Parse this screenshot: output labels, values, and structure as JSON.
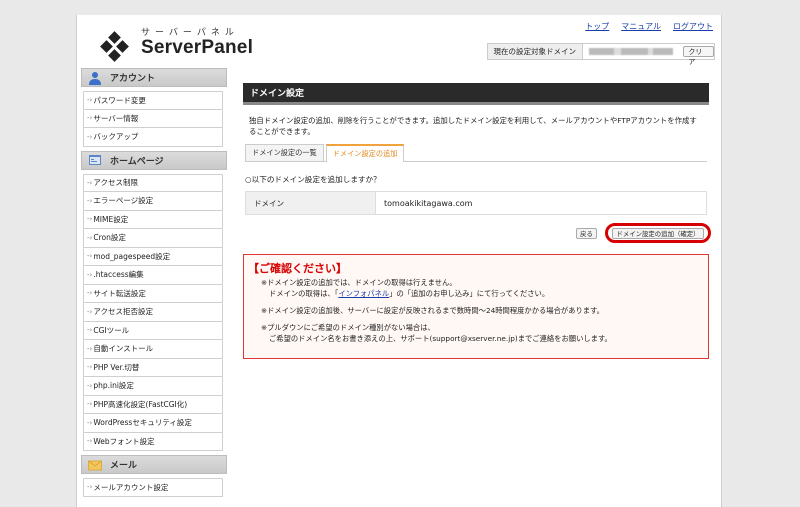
{
  "header": {
    "logo_kana": "サーバーパネル",
    "logo_word": "ServerPanel",
    "links": [
      "トップ",
      "マニュアル",
      "ログアウト"
    ],
    "target_label": "現在の設定対象ドメイン",
    "clear_label": "クリア"
  },
  "sidebar": {
    "sections": [
      {
        "title": "アカウント",
        "icon": "user-icon",
        "items": [
          "パスワード変更",
          "サーバー情報",
          "バックアップ"
        ]
      },
      {
        "title": "ホームページ",
        "icon": "homepage-icon",
        "items": [
          "アクセス制限",
          "エラーページ設定",
          "MIME設定",
          "Cron設定",
          "mod_pagespeed設定",
          ".htaccess編集",
          "サイト転送設定",
          "アクセス拒否設定",
          "CGIツール",
          "自動インストール",
          "PHP Ver.切替",
          "php.ini設定",
          "PHP高速化設定(FastCGI化)",
          "WordPressセキュリティ設定",
          "Webフォント設定"
        ]
      },
      {
        "title": "メール",
        "icon": "mail-icon",
        "items": [
          "メールアカウント設定"
        ]
      }
    ]
  },
  "main": {
    "title": "ドメイン設定",
    "description": "独自ドメイン設定の追加、削除を行うことができます。追加したドメイン設定を利用して、メールアカウントやFTPアカウントを作成することができます。",
    "tabs": [
      "ドメイン設定の一覧",
      "ドメイン設定の追加"
    ],
    "question": "○以下のドメイン設定を追加しますか？",
    "domain_label": "ドメイン",
    "domain_value": "tomoakikitagawa.com",
    "back_label": "戻る",
    "confirm_label": "ドメイン設定の追加（確定）"
  },
  "notice": {
    "title": "【ご確認ください】",
    "line1": "※ドメイン設定の追加では、ドメインの取得は行えません。",
    "line2_pre": "ドメインの取得は、「",
    "line2_link": "インフォパネル",
    "line2_post": "」の「追加のお申し込み」にて行ってください。",
    "line3": "※ドメイン設定の追加後、サーバーに設定が反映されるまで数時間〜24時間程度かかる場合があります。",
    "line4": "※プルダウンにご希望のドメイン種別がない場合は、",
    "line5": "ご希望のドメイン名をお書き添えの上、サポート(support@xserver.ne.jp)までご連絡をお願いします。"
  },
  "colors": {
    "accent_tab": "#e08a1e",
    "highlight_ring": "#d60000",
    "notice_border": "#e03535"
  }
}
